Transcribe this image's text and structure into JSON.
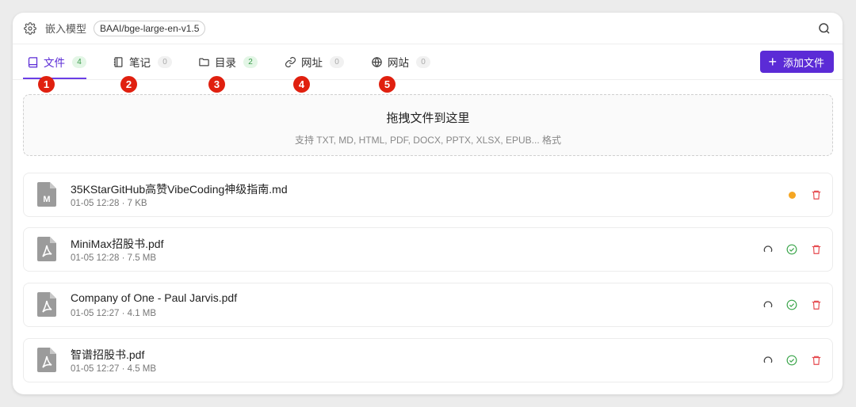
{
  "header": {
    "settings_icon": "gear-icon",
    "label": "嵌入模型",
    "model": "BAAI/bge-large-en-v1.5",
    "search_icon": "search-icon"
  },
  "tabs": [
    {
      "label": "文件",
      "count": "4",
      "icon": "book-icon",
      "active": true,
      "badge": "1"
    },
    {
      "label": "笔记",
      "count": "0",
      "icon": "notebook-icon",
      "active": false,
      "badge": "2"
    },
    {
      "label": "目录",
      "count": "2",
      "icon": "folder-icon",
      "active": false,
      "badge": "3"
    },
    {
      "label": "网址",
      "count": "0",
      "icon": "link-icon",
      "active": false,
      "badge": "4"
    },
    {
      "label": "网站",
      "count": "0",
      "icon": "globe-icon",
      "active": false,
      "badge": "5"
    }
  ],
  "add_button": {
    "label": "添加文件"
  },
  "dropzone": {
    "title": "拖拽文件到这里",
    "subtitle": "支持 TXT, MD, HTML, PDF, DOCX, PPTX, XLSX, EPUB... 格式"
  },
  "files": [
    {
      "name": "35KStarGitHub高赞VibeCoding神级指南.md",
      "meta": "01-05 12:28 · 7 KB",
      "type": "md",
      "status": "processing",
      "status_color": "#f5a623"
    },
    {
      "name": "MiniMax招股书.pdf",
      "meta": "01-05 12:28 · 7.5 MB",
      "type": "pdf",
      "status": "done"
    },
    {
      "name": "Company of One - Paul Jarvis.pdf",
      "meta": "01-05 12:27 · 4.1 MB",
      "type": "pdf",
      "status": "done"
    },
    {
      "name": "智谱招股书.pdf",
      "meta": "01-05 12:27 · 4.5 MB",
      "type": "pdf",
      "status": "done"
    }
  ],
  "colors": {
    "accent": "#5b2bd6",
    "badge": "#e0200f",
    "success": "#3aa54a",
    "delete": "#e5484d"
  }
}
